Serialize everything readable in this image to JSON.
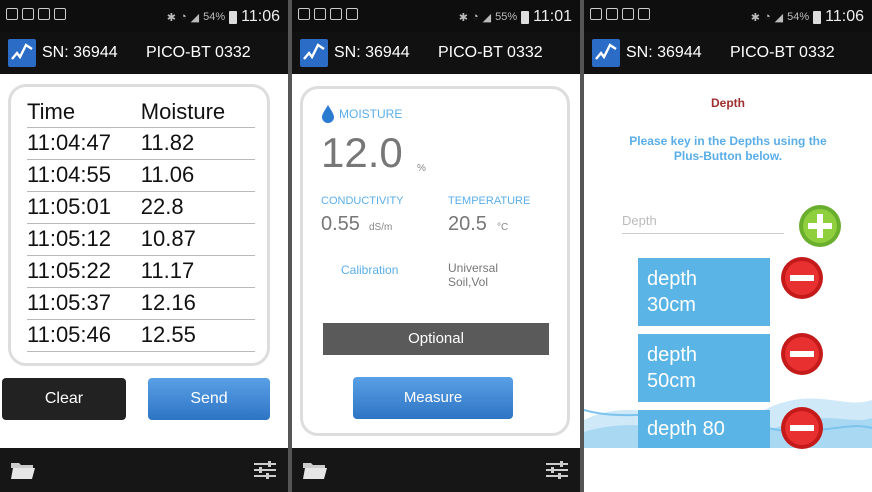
{
  "colors": {
    "accent": "#5aaee8",
    "button_blue": "#3a86d6",
    "dark": "#111111",
    "depth_item": "#5ab4e6",
    "depth_title": "#a03030"
  },
  "screens": [
    {
      "status": {
        "time": "11:06",
        "battery": "54%"
      },
      "header": {
        "sn": "SN: 36944",
        "model": "PICO-BT 0332"
      },
      "table": {
        "columns": [
          "Time",
          "Moisture"
        ],
        "rows": [
          [
            "11:04:47",
            "11.82"
          ],
          [
            "11:04:55",
            "11.06"
          ],
          [
            "11:05:01",
            "22.8"
          ],
          [
            "11:05:12",
            "10.87"
          ],
          [
            "11:05:22",
            "11.17"
          ],
          [
            "11:05:37",
            "12.16"
          ],
          [
            "11:05:46",
            "12.55"
          ]
        ]
      },
      "buttons": {
        "clear": "Clear",
        "send": "Send"
      },
      "icons": {
        "left": "folder-icon",
        "right": "settings-sliders-icon"
      }
    },
    {
      "status": {
        "time": "11:01",
        "battery": "55%"
      },
      "header": {
        "sn": "SN: 36944",
        "model": "PICO-BT 0332"
      },
      "moisture": {
        "label": "MOISTURE",
        "value": "12.0",
        "unit": "%"
      },
      "conductivity": {
        "label": "CONDUCTIVITY",
        "value": "0.55",
        "unit": "dS/m"
      },
      "temperature": {
        "label": "TEMPERATURE",
        "value": "20.5",
        "unit": "°C"
      },
      "calibration": {
        "label": "Calibration",
        "value_line1": "Universal",
        "value_line2": "Soil,Vol"
      },
      "optional": "Optional",
      "measure": "Measure",
      "icons": {
        "left": "folder-icon",
        "right": "settings-sliders-icon"
      }
    },
    {
      "status": {
        "time": "11:06",
        "battery": "54%"
      },
      "header": {
        "sn": "SN: 36944",
        "model": "PICO-BT 0332"
      },
      "title": "Depth",
      "instruction_line1": "Please key in the Depths using the",
      "instruction_line2": "Plus-Button below.",
      "input": {
        "placeholder": "Depth",
        "value": ""
      },
      "depths": [
        {
          "line1": "depth",
          "line2": "30cm"
        },
        {
          "line1": "depth",
          "line2": "50cm"
        },
        {
          "line1": "depth 80",
          "line2": ""
        }
      ]
    }
  ]
}
